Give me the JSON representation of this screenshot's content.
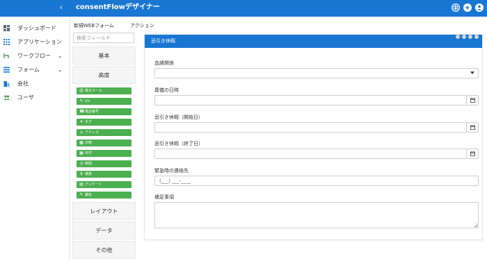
{
  "header": {
    "title": "consentFlowデザイナー",
    "collapse_label": "‹",
    "right_icons": [
      "globe-icon",
      "logout-icon",
      "user-icon"
    ]
  },
  "sidebar": {
    "items": [
      {
        "label": "ダッシュボード",
        "icon": "dashboard-icon",
        "has_chevron": false
      },
      {
        "label": "アプリケーション",
        "icon": "apps-grid-icon",
        "has_chevron": false
      },
      {
        "label": "ワークフロー",
        "icon": "workflow-icon",
        "has_chevron": true
      },
      {
        "label": "フォーム",
        "icon": "form-list-icon",
        "has_chevron": true
      },
      {
        "label": "会社",
        "icon": "company-icon",
        "has_chevron": false
      },
      {
        "label": "ユーザ",
        "icon": "users-icon",
        "has_chevron": false
      }
    ],
    "chevron": "⌄"
  },
  "tabs": [
    "新規WEBフォーム",
    "アクション"
  ],
  "palette": {
    "search_placeholder": "検索フィールド",
    "sections": {
      "basic": "基本",
      "advanced": "高度",
      "layout": "レイアウト",
      "data": "データ",
      "other": "その他"
    },
    "components": [
      {
        "label": "電子メール",
        "icon": "@"
      },
      {
        "label": "Url",
        "icon": "✎"
      },
      {
        "label": "電話番号",
        "icon": "☎"
      },
      {
        "label": "タグ",
        "icon": "✦"
      },
      {
        "label": "アドレス",
        "icon": "⌂"
      },
      {
        "label": "日時",
        "icon": "▦"
      },
      {
        "label": "日付",
        "icon": "▦"
      },
      {
        "label": "時間",
        "icon": "◷"
      },
      {
        "label": "通貨",
        "icon": "$"
      },
      {
        "label": "アンケート",
        "icon": "▤"
      },
      {
        "label": "署名",
        "icon": "✎"
      }
    ]
  },
  "form": {
    "title": "忌引き休暇",
    "fields": [
      {
        "label": "血縁関係",
        "type": "select",
        "value": ""
      },
      {
        "label": "葬儀の日時",
        "type": "datetime",
        "value": ""
      },
      {
        "label": "忌引き休暇（開始日）",
        "type": "date",
        "value": ""
      },
      {
        "label": "忌引き休暇（終了日）",
        "type": "date",
        "value": ""
      },
      {
        "label": "緊急時の連絡先",
        "type": "phone",
        "value": "(___) ___-____"
      },
      {
        "label": "補足事項",
        "type": "textarea",
        "value": ""
      }
    ]
  },
  "colors": {
    "primary": "#1976d2",
    "component_green": "#4caf50"
  }
}
